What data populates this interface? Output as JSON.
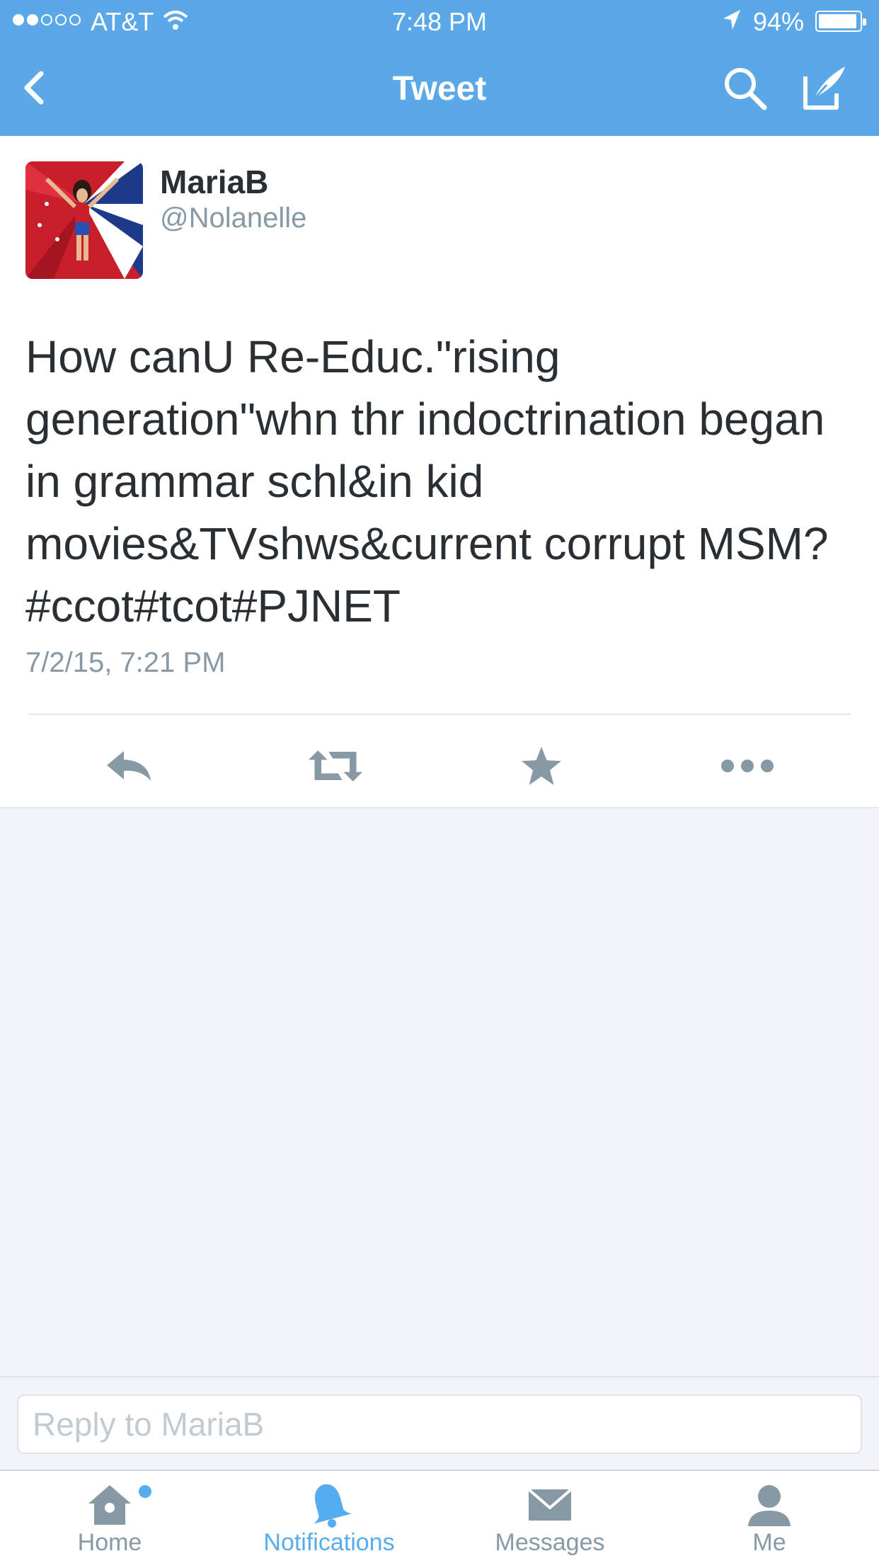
{
  "status_bar": {
    "carrier": "AT&T",
    "time": "7:48 PM",
    "battery_percent": "94%",
    "signal_bars_filled": 2,
    "signal_bars_total": 5
  },
  "nav": {
    "title": "Tweet"
  },
  "tweet": {
    "author_name": "MariaB",
    "author_handle": "@Nolanelle",
    "text": "How canU Re-Educ.\"rising generation\"whn thr indoctrination began in grammar schl&in kid movies&TVshws&current corrupt MSM? #ccot#tcot#PJNET",
    "timestamp": "7/2/15, 7:21 PM"
  },
  "reply": {
    "placeholder": "Reply to MariaB"
  },
  "tabs": [
    {
      "label": "Home",
      "icon": "home-icon",
      "active": false,
      "has_dot": true
    },
    {
      "label": "Notifications",
      "icon": "bell-icon",
      "active": true
    },
    {
      "label": "Messages",
      "icon": "envelope-icon",
      "active": false
    },
    {
      "label": "Me",
      "icon": "person-icon",
      "active": false
    }
  ],
  "colors": {
    "brand": "#5aa8e8",
    "active_tab": "#55acee",
    "icon_gray": "#8899a6",
    "text": "#292f33"
  }
}
